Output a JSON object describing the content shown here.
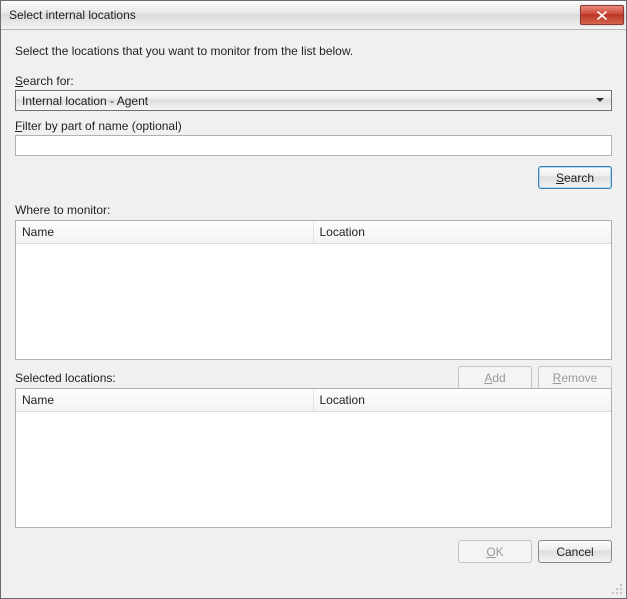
{
  "window": {
    "title": "Select internal locations"
  },
  "instruction": "Select the locations that you want to monitor from the list below.",
  "search": {
    "label_plain": "Search for:",
    "label_accel": "S",
    "label_rest": "earch for:",
    "selected": "Internal location - Agent",
    "filter_label_accel": "F",
    "filter_label_rest": "ilter by part of name (optional)",
    "filter_value": "",
    "search_btn_accel": "S",
    "search_btn_rest": "earch"
  },
  "lists": {
    "monitor_label": "Where to monitor:",
    "selected_label": "Selected locations:",
    "columns": {
      "name": "Name",
      "location": "Location"
    }
  },
  "buttons": {
    "add_accel": "A",
    "add_rest": "dd",
    "remove_accel": "R",
    "remove_rest": "emove",
    "ok_accel": "O",
    "ok_rest": "K",
    "cancel": "Cancel"
  }
}
